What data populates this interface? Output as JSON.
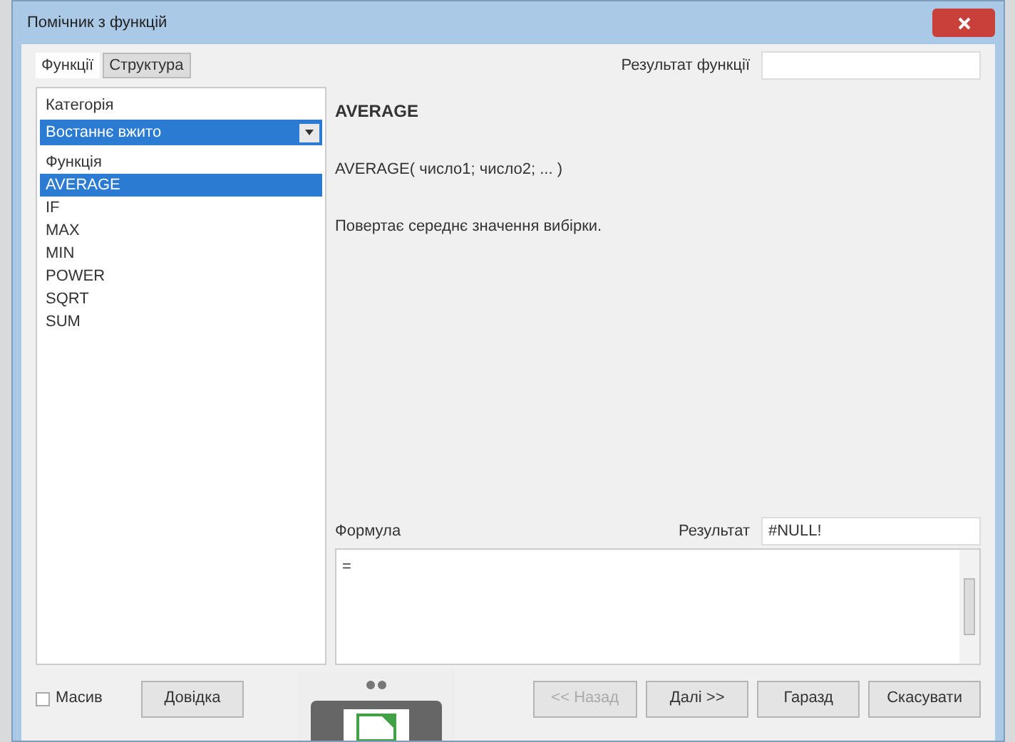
{
  "window": {
    "title": "Помічник з функцій"
  },
  "tabs": [
    {
      "label": "Функції",
      "selected": true
    },
    {
      "label": "Структура",
      "selected": false
    }
  ],
  "function_result": {
    "label": "Результат функції"
  },
  "category": {
    "label": "Категорія",
    "value": "Востаннє вжито"
  },
  "functions": {
    "label": "Функція",
    "items": [
      {
        "label": "AVERAGE",
        "selected": true
      },
      {
        "label": "IF",
        "selected": false
      },
      {
        "label": "MAX",
        "selected": false
      },
      {
        "label": "MIN",
        "selected": false
      },
      {
        "label": "POWER",
        "selected": false
      },
      {
        "label": "SQRT",
        "selected": false
      },
      {
        "label": "SUM",
        "selected": false
      }
    ]
  },
  "details": {
    "name": "AVERAGE",
    "syntax": "AVERAGE( число1; число2; ... )",
    "description": "Повертає середнє значення вибірки."
  },
  "formula": {
    "label": "Формула",
    "value": "=",
    "result_label": "Результат",
    "result_value": "#NULL!"
  },
  "array": {
    "label": "Масив",
    "checked": false
  },
  "buttons": [
    {
      "label": "Довідка",
      "disabled": false
    },
    {
      "label": "<< Назад",
      "disabled": true
    },
    {
      "label": "Далі >>",
      "disabled": false
    },
    {
      "label": "Гаразд",
      "disabled": false
    },
    {
      "label": "Скасувати",
      "disabled": false
    }
  ]
}
